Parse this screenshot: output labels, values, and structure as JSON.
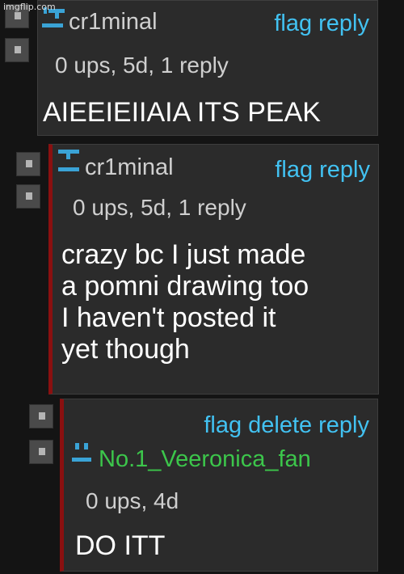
{
  "watermark": "imgflip.com",
  "comments": [
    {
      "username": "cr1minal",
      "actions": [
        "flag",
        "reply"
      ],
      "meta": "0 ups, 5d, 1 reply",
      "text": "AIEEIEIIAIA ITS PEAK",
      "username_color": "#cfcfcf"
    },
    {
      "username": "cr1minal",
      "actions": [
        "flag",
        "reply"
      ],
      "meta": "0 ups, 5d, 1 reply",
      "text_lines": [
        "crazy bc I just made",
        "a pomni drawing too",
        "I haven't posted it",
        "yet though"
      ],
      "username_color": "#cfcfcf"
    },
    {
      "username": "No.1_Veeronica_fan",
      "actions": [
        "flag",
        "delete",
        "reply"
      ],
      "meta": "0 ups, 4d",
      "text": "DO ITT",
      "username_color": "#3cc64b"
    }
  ],
  "colors": {
    "link": "#42c2f2",
    "thread_line": "#8a1010",
    "background": "#141414",
    "card": "#2b2b2b"
  }
}
